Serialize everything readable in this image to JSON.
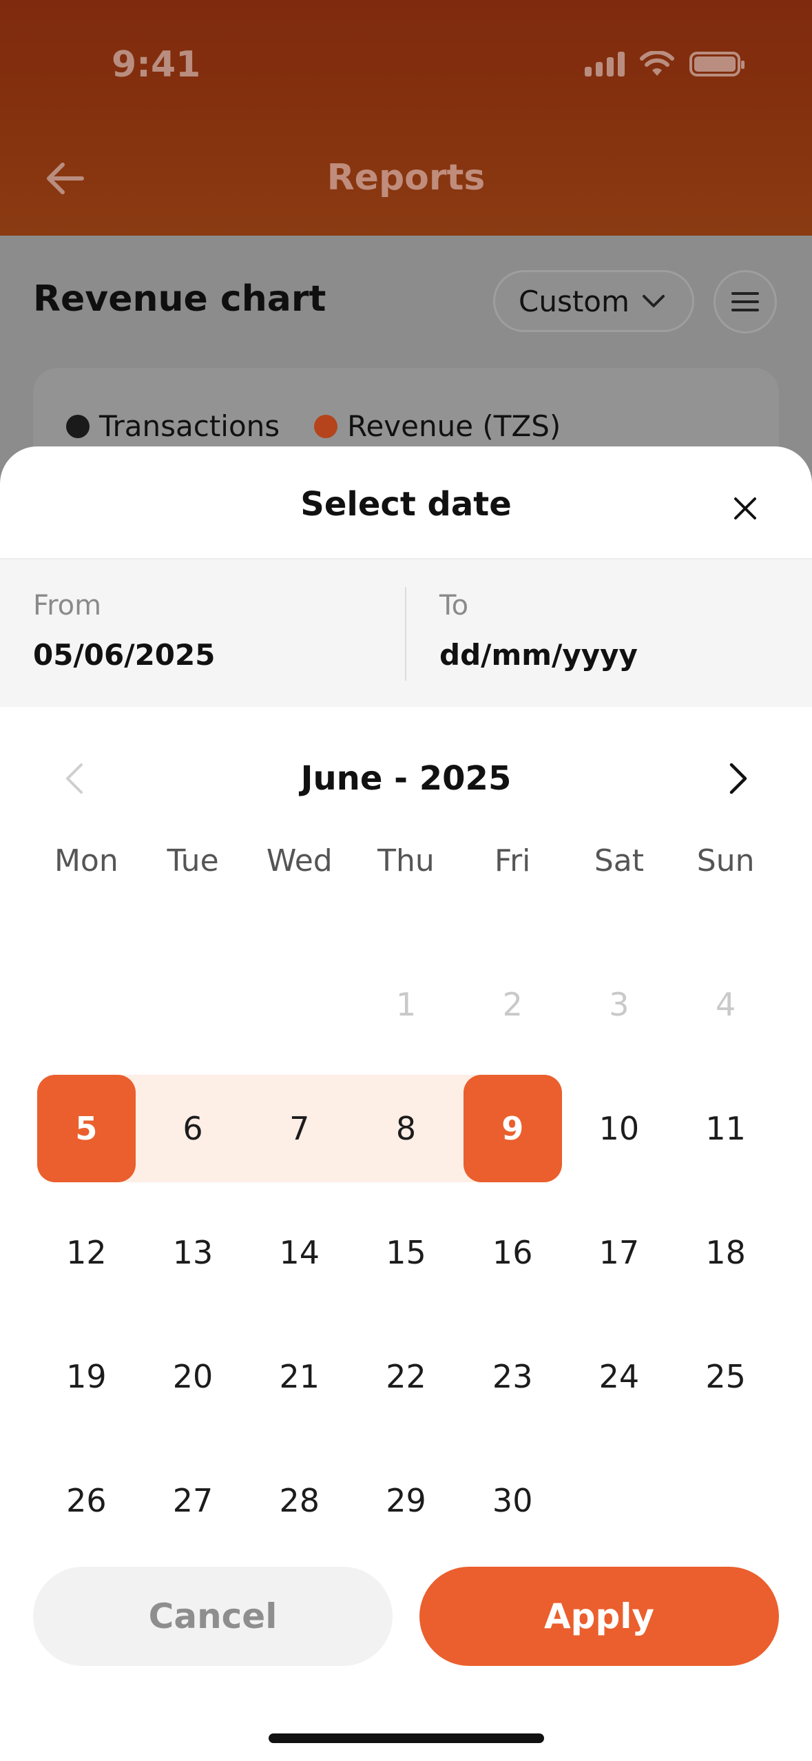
{
  "status_bar": {
    "time": "9:41"
  },
  "header": {
    "title": "Reports"
  },
  "background": {
    "section_title": "Revenue chart",
    "period_select": {
      "value": "Custom"
    },
    "legend": [
      {
        "label": "Transactions",
        "color": "#1a1a1a"
      },
      {
        "label": "Revenue (TZS)",
        "color": "#b5441c"
      }
    ]
  },
  "sheet": {
    "title": "Select date",
    "from": {
      "label": "From",
      "value": "05/06/2025"
    },
    "to": {
      "label": "To",
      "value": "dd/mm/yyyy"
    },
    "month_label": "June - 2025",
    "weekdays": [
      "Mon",
      "Tue",
      "Wed",
      "Thu",
      "Fri",
      "Sat",
      "Sun"
    ],
    "weeks": [
      [
        "",
        "",
        "",
        "1",
        "2",
        "3",
        "4"
      ],
      [
        "5",
        "6",
        "7",
        "8",
        "9",
        "10",
        "11"
      ],
      [
        "12",
        "13",
        "14",
        "15",
        "16",
        "17",
        "18"
      ],
      [
        "19",
        "20",
        "21",
        "22",
        "23",
        "24",
        "25"
      ],
      [
        "26",
        "27",
        "28",
        "29",
        "30",
        "",
        ""
      ]
    ],
    "disabled_days": [
      "1",
      "2",
      "3",
      "4"
    ],
    "range_start": "5",
    "range_end": "9",
    "cancel_label": "Cancel",
    "apply_label": "Apply"
  },
  "colors": {
    "accent": "#ea5f2d",
    "range_fill": "#fdeee6"
  }
}
